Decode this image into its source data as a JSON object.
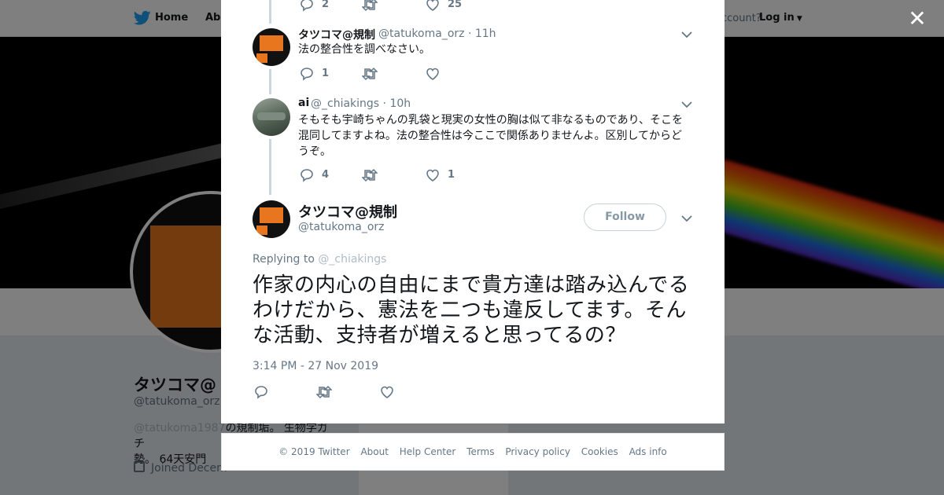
{
  "background": {
    "nav": {
      "home_label": "Home",
      "about_label": "Abo",
      "account_prompt": "ccount?",
      "login_label": "Log in"
    },
    "profile": {
      "name": "タツコマ@",
      "handle": "@tatukoma_orz",
      "bio_mention": "@tatukoma1987",
      "bio_line1_rest": "の規制垢。 生物学ガチ",
      "bio_line2": "勢。 64天安門",
      "joined": "Joined Decem"
    }
  },
  "close_label": "✕",
  "thread": {
    "prev_actions": {
      "reply_count": "2",
      "retweet_count": "",
      "like_count": "25"
    },
    "tweets": [
      {
        "name": "タツコマ@規制",
        "handle": "@tatukoma_orz",
        "time": "11h",
        "text": "法の整合性を調べなさい。",
        "reply_count": "1",
        "retweet_count": "",
        "like_count": ""
      },
      {
        "name": "ai",
        "handle": "@_chiakings",
        "time": "10h",
        "text": "そもそも宇崎ちゃんの乳袋と現実の女性の胸は似て非なるものであり、そこを混同してますよね。法の整合性は今ここで関係ありませんよ。区別してからどうぞ。",
        "reply_count": "4",
        "retweet_count": "",
        "like_count": "1"
      }
    ]
  },
  "main_tweet": {
    "name": "タツコマ@規制",
    "handle": "@tatukoma_orz",
    "follow_label": "Follow",
    "replying_prefix": "Replying to",
    "replying_to": "@_chiakings",
    "text": "作家の内心の自由にまで貴方達は踏み込んでるわけだから、憲法を二つも違反してます。そんな活動、支持者が増えると思ってるの？",
    "timestamp": "3:14 PM - 27 Nov 2019"
  },
  "footer": {
    "links": [
      "© 2019 Twitter",
      "About",
      "Help Center",
      "Terms",
      "Privacy policy",
      "Cookies",
      "Ads info"
    ]
  },
  "colors": {
    "twitter_blue": "#1da1f2",
    "text_primary": "#14171a",
    "text_secondary": "#657786",
    "thread_line": "#ccd6dd"
  }
}
